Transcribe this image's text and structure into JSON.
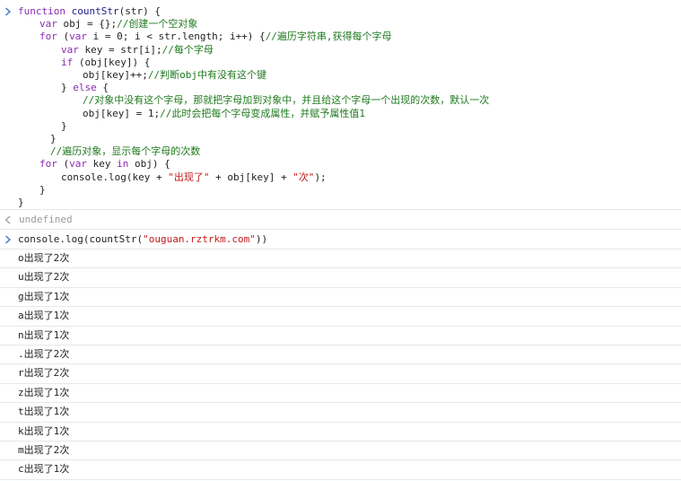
{
  "input_1": {
    "lines": [
      {
        "indent": 0,
        "segments": [
          [
            "kw",
            "function"
          ],
          [
            "fn",
            " countStr"
          ],
          [
            "pl",
            "(str) {"
          ]
        ]
      },
      {
        "indent": 1,
        "segments": [
          [
            "kw",
            "var"
          ],
          [
            "pl",
            " obj = {};"
          ],
          [
            "cm",
            "//创建一个空对象"
          ]
        ]
      },
      {
        "indent": 1,
        "segments": [
          [
            "kw",
            "for"
          ],
          [
            "pl",
            " ("
          ],
          [
            "kw",
            "var"
          ],
          [
            "pl",
            " i = 0; i < str.length; i++) {"
          ],
          [
            "cm",
            "//遍历字符串,获得每个字母"
          ]
        ]
      },
      {
        "indent": 2,
        "segments": [
          [
            "kw",
            "var"
          ],
          [
            "pl",
            " key = str[i];"
          ],
          [
            "cm",
            "//每个字母"
          ]
        ]
      },
      {
        "indent": 2,
        "segments": [
          [
            "kw",
            "if"
          ],
          [
            "pl",
            " (obj[key]) {"
          ]
        ]
      },
      {
        "indent": 3,
        "segments": [
          [
            "pl",
            "obj[key]++;"
          ],
          [
            "cm",
            "//判断obj中有没有这个键"
          ]
        ]
      },
      {
        "indent": 2,
        "segments": [
          [
            "pl",
            "} "
          ],
          [
            "kw",
            "else"
          ],
          [
            "pl",
            " {"
          ]
        ]
      },
      {
        "indent": 3,
        "segments": [
          [
            "cm",
            "//对象中没有这个字母，那就把字母加到对象中，并且给这个字母一个出现的次数，默认一次"
          ]
        ]
      },
      {
        "indent": 3,
        "segments": [
          [
            "pl",
            "obj[key] = 1;"
          ],
          [
            "cm",
            "//此时会把每个字母变成属性，并赋予属性值1"
          ]
        ]
      },
      {
        "indent": 2,
        "segments": [
          [
            "pl",
            "}"
          ]
        ]
      },
      {
        "indent": 1.5,
        "segments": [
          [
            "pl",
            "}"
          ]
        ]
      },
      {
        "indent": 1.5,
        "segments": [
          [
            "cm",
            "//遍历对象，显示每个字母的次数"
          ]
        ]
      },
      {
        "indent": 1,
        "segments": [
          [
            "kw",
            "for"
          ],
          [
            "pl",
            " ("
          ],
          [
            "kw",
            "var"
          ],
          [
            "pl",
            " key "
          ],
          [
            "kw",
            "in"
          ],
          [
            "pl",
            " obj) {"
          ]
        ]
      },
      {
        "indent": 2,
        "segments": [
          [
            "pl",
            "console.log(key + "
          ],
          [
            "str",
            "\"出现了\""
          ],
          [
            "pl",
            " + obj[key] + "
          ],
          [
            "str",
            "\"次\""
          ],
          [
            "pl",
            ");"
          ]
        ]
      },
      {
        "indent": 1,
        "segments": [
          [
            "pl",
            "}"
          ]
        ]
      },
      {
        "indent": 0,
        "segments": [
          [
            "pl",
            "}"
          ]
        ]
      }
    ]
  },
  "result_1": "undefined",
  "input_2": {
    "segments": [
      [
        "pl",
        "console.log(countStr("
      ],
      [
        "str",
        "\"ouguan.rztrkm.com\""
      ],
      [
        "pl",
        "))"
      ]
    ]
  },
  "log_outputs": [
    "o出现了2次",
    "u出现了2次",
    "g出现了1次",
    "a出现了1次",
    "n出现了1次",
    ".出现了2次",
    "r出现了2次",
    "z出现了1次",
    "t出现了1次",
    "k出现了1次",
    "m出现了2次",
    "c出现了1次"
  ],
  "colors": {
    "keyword": "#8a2bb5",
    "string": "#c21a1a",
    "comment": "#1f7a1f",
    "prompt": "#3a78c9",
    "divider": "#e4e8ee"
  },
  "icons": {
    "input_prompt": "chevron-right-icon",
    "result_prompt": "chevron-left-icon"
  }
}
